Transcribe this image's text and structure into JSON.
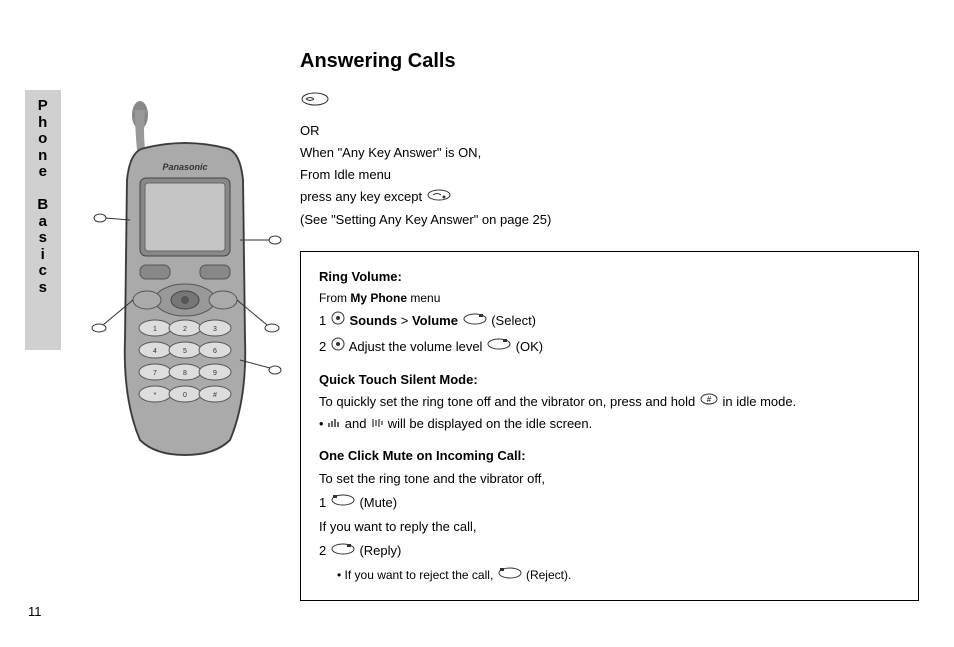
{
  "sideTab": "Phone Basics",
  "title": "Answering Calls",
  "intro": {
    "or": "OR",
    "line1": "When \"Any Key Answer\" is ON,",
    "line2": "From Idle menu",
    "line3a": "press any key except ",
    "line4": "(See \"Setting Any Key Answer\" on page 25)"
  },
  "box": {
    "ringVolume": {
      "heading": "Ring Volume:",
      "from": "From ",
      "fromBold": "My Phone",
      "fromAfter": " menu",
      "step1a": "1   ",
      "step1b": "   ",
      "step1Sounds": "Sounds",
      "step1Gt": " > ",
      "step1Volume": "Volume",
      "step1End": "   (Select)",
      "step2a": "2   ",
      "step2b": "   Adjust the volume level   ",
      "step2End": "(OK)"
    },
    "quickTouch": {
      "heading": "Quick Touch Silent Mode:",
      "line1a": "To quickly set the ring tone off and the vibrator on, press and hold  ",
      "line1b": "  in idle mode.",
      "bullet1a": "• ",
      "bullet1b": "  and  ",
      "bullet1c": "  will be displayed on the idle screen."
    },
    "oneClickMute": {
      "heading": "One Click Mute on Incoming Call:",
      "line1": "To set the ring tone and  the vibrator off,",
      "step1a": "1   ",
      "step1b": " (Mute)",
      "line2": "If you want to reply the call,",
      "step2a": "2   ",
      "step2b": " (Reply)",
      "reject": "• If you want to reject the call,   ",
      "rejectEnd": " (Reject)."
    }
  },
  "pageNumber": "11"
}
